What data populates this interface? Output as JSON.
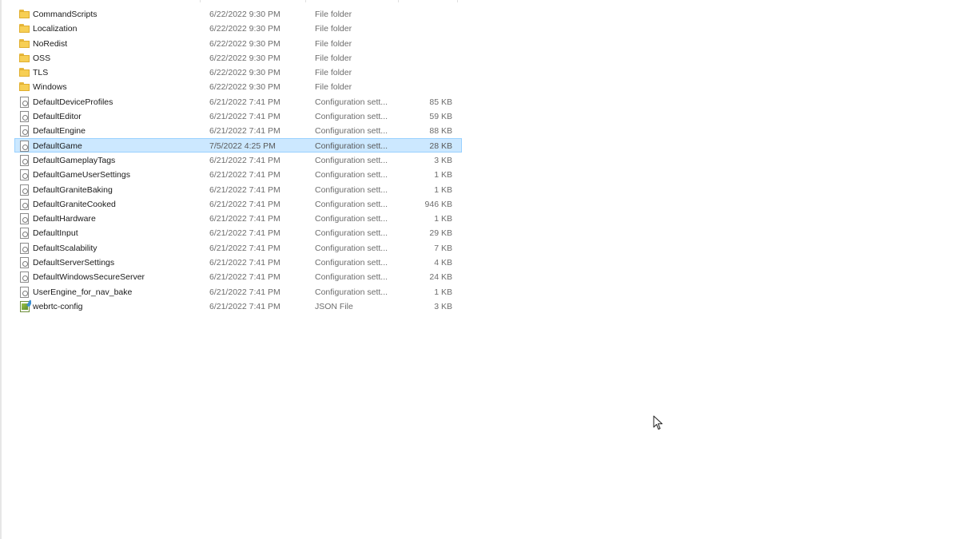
{
  "files": [
    {
      "name": "CommandScripts",
      "date": "6/22/2022 9:30 PM",
      "type": "File folder",
      "size": "",
      "icon": "folder-icon"
    },
    {
      "name": "Localization",
      "date": "6/22/2022 9:30 PM",
      "type": "File folder",
      "size": "",
      "icon": "folder-icon"
    },
    {
      "name": "NoRedist",
      "date": "6/22/2022 9:30 PM",
      "type": "File folder",
      "size": "",
      "icon": "folder-icon"
    },
    {
      "name": "OSS",
      "date": "6/22/2022 9:30 PM",
      "type": "File folder",
      "size": "",
      "icon": "folder-icon"
    },
    {
      "name": "TLS",
      "date": "6/22/2022 9:30 PM",
      "type": "File folder",
      "size": "",
      "icon": "folder-icon"
    },
    {
      "name": "Windows",
      "date": "6/22/2022 9:30 PM",
      "type": "File folder",
      "size": "",
      "icon": "folder-icon"
    },
    {
      "name": "DefaultDeviceProfiles",
      "date": "6/21/2022 7:41 PM",
      "type": "Configuration sett...",
      "size": "85 KB",
      "icon": "config-file-icon"
    },
    {
      "name": "DefaultEditor",
      "date": "6/21/2022 7:41 PM",
      "type": "Configuration sett...",
      "size": "59 KB",
      "icon": "config-file-icon"
    },
    {
      "name": "DefaultEngine",
      "date": "6/21/2022 7:41 PM",
      "type": "Configuration sett...",
      "size": "88 KB",
      "icon": "config-file-icon"
    },
    {
      "name": "DefaultGame",
      "date": "7/5/2022 4:25 PM",
      "type": "Configuration sett...",
      "size": "28 KB",
      "icon": "config-file-icon",
      "selected": true
    },
    {
      "name": "DefaultGameplayTags",
      "date": "6/21/2022 7:41 PM",
      "type": "Configuration sett...",
      "size": "3 KB",
      "icon": "config-file-icon"
    },
    {
      "name": "DefaultGameUserSettings",
      "date": "6/21/2022 7:41 PM",
      "type": "Configuration sett...",
      "size": "1 KB",
      "icon": "config-file-icon"
    },
    {
      "name": "DefaultGraniteBaking",
      "date": "6/21/2022 7:41 PM",
      "type": "Configuration sett...",
      "size": "1 KB",
      "icon": "config-file-icon"
    },
    {
      "name": "DefaultGraniteCooked",
      "date": "6/21/2022 7:41 PM",
      "type": "Configuration sett...",
      "size": "946 KB",
      "icon": "config-file-icon"
    },
    {
      "name": "DefaultHardware",
      "date": "6/21/2022 7:41 PM",
      "type": "Configuration sett...",
      "size": "1 KB",
      "icon": "config-file-icon"
    },
    {
      "name": "DefaultInput",
      "date": "6/21/2022 7:41 PM",
      "type": "Configuration sett...",
      "size": "29 KB",
      "icon": "config-file-icon"
    },
    {
      "name": "DefaultScalability",
      "date": "6/21/2022 7:41 PM",
      "type": "Configuration sett...",
      "size": "7 KB",
      "icon": "config-file-icon"
    },
    {
      "name": "DefaultServerSettings",
      "date": "6/21/2022 7:41 PM",
      "type": "Configuration sett...",
      "size": "4 KB",
      "icon": "config-file-icon"
    },
    {
      "name": "DefaultWindowsSecureServer",
      "date": "6/21/2022 7:41 PM",
      "type": "Configuration sett...",
      "size": "24 KB",
      "icon": "config-file-icon"
    },
    {
      "name": "UserEngine_for_nav_bake",
      "date": "6/21/2022 7:41 PM",
      "type": "Configuration sett...",
      "size": "1 KB",
      "icon": "config-file-icon"
    },
    {
      "name": "webrtc-config",
      "date": "6/21/2022 7:41 PM",
      "type": "JSON File",
      "size": "3 KB",
      "icon": "json-file-icon"
    }
  ],
  "colors": {
    "selection_bg": "#cce8ff",
    "selection_border": "#99d1ff",
    "folder": "#f7cf55",
    "secondary_text": "#6d6d6d"
  }
}
